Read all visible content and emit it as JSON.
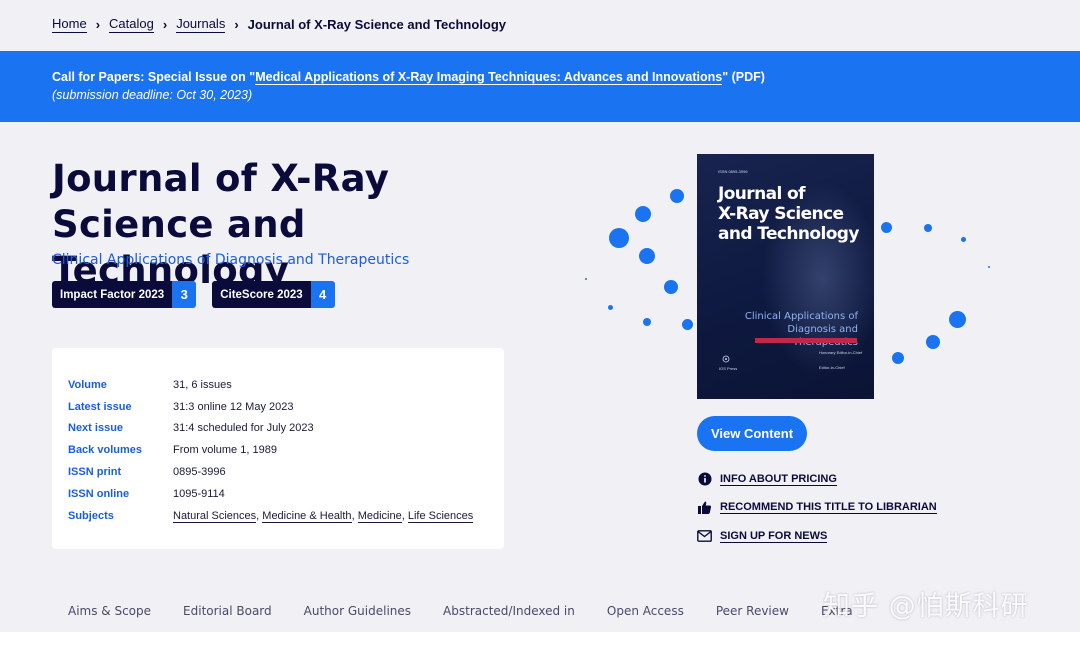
{
  "breadcrumb": {
    "items": [
      "Home",
      "Catalog",
      "Journals"
    ],
    "current": "Journal of X-Ray Science and Technology"
  },
  "banner": {
    "prefix": "Call for Papers: Special Issue on \"",
    "link": "Medical Applications of X-Ray Imaging Techniques: Advances and Innovations",
    "suffix": "\" (PDF)",
    "deadline": "(submission deadline: Oct 30, 2023)"
  },
  "journal": {
    "title": "Journal of X-Ray Science and Technology",
    "subtitle": "Clinical Applications of Diagnosis and Therapeutics"
  },
  "metrics": [
    {
      "label": "Impact Factor 2023",
      "value": "3"
    },
    {
      "label": "CiteScore 2023",
      "value": "4"
    }
  ],
  "info": {
    "rows": [
      {
        "key": "Volume",
        "value": "31, 6 issues"
      },
      {
        "key": "Latest issue",
        "value": "31:3 online 12 May 2023"
      },
      {
        "key": "Next issue",
        "value": "31:4 scheduled for July 2023"
      },
      {
        "key": "Back volumes",
        "value": "From volume 1, 1989"
      },
      {
        "key": "ISSN print",
        "value": "0895-3996"
      },
      {
        "key": "ISSN online",
        "value": "1095-9114"
      }
    ],
    "subjects_key": "Subjects",
    "subjects": [
      "Natural Sciences",
      "Medicine & Health",
      "Medicine",
      "Life Sciences"
    ]
  },
  "cover": {
    "issn": "ISSN 0895-3996",
    "title_lines": [
      "Journal of",
      "X-Ray Science",
      "and Technology"
    ],
    "subtitle": "Clinical Applications of Diagnosis and Therapeutics",
    "editor1": "Honorary Editor-in-Chief",
    "editor2": "Editor-in-Chief",
    "publisher": "IOS Press"
  },
  "view_button": "View Content",
  "actions": [
    {
      "icon": "info-icon",
      "label": "INFO ABOUT PRICING"
    },
    {
      "icon": "thumbs-up-icon",
      "label": "RECOMMEND THIS TITLE TO LIBRARIAN"
    },
    {
      "icon": "envelope-icon",
      "label": "SIGN UP FOR NEWS"
    }
  ],
  "tabs": [
    "Aims & Scope",
    "Editorial Board",
    "Author Guidelines",
    "Abstracted/Indexed in",
    "Open Access",
    "Peer Review",
    "Extra"
  ],
  "watermark": "知乎 @怕斯科研",
  "colors": {
    "accent": "#1a73f0",
    "navy": "#0b0b3b",
    "cover_red": "#c0284a"
  }
}
